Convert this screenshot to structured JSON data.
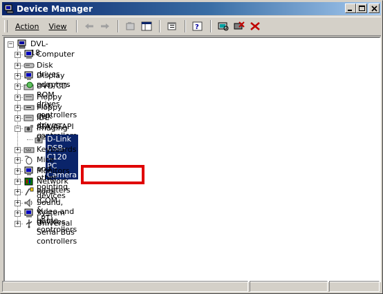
{
  "window": {
    "title": "Device Manager",
    "title_color": "#0a246a"
  },
  "toolbar": {
    "menu_action": "Action",
    "menu_view": "View",
    "buttons": [
      "back-icon",
      "forward-icon",
      "up-icon",
      "properties-pane-icon",
      "properties-icon",
      "help-icon",
      "scan-hardware-icon",
      "uninstall-icon",
      "disable-icon"
    ]
  },
  "tree": {
    "root": "DVL-18",
    "items": [
      {
        "label": "Computer",
        "icon": "computer-icon",
        "expanded": false
      },
      {
        "label": "Disk drives",
        "icon": "disk-drive-icon",
        "expanded": false
      },
      {
        "label": "Display adapters",
        "icon": "display-icon",
        "expanded": false
      },
      {
        "label": "DVD/CD-ROM drives",
        "icon": "cdrom-icon",
        "expanded": false
      },
      {
        "label": "Floppy disk controllers",
        "icon": "floppy-controller-icon",
        "expanded": false
      },
      {
        "label": "Floppy disk drives",
        "icon": "floppy-drive-icon",
        "expanded": false
      },
      {
        "label": "IDE ATA/ATAPI controllers",
        "icon": "ide-controller-icon",
        "expanded": false
      },
      {
        "label": "Imaging devices",
        "icon": "camera-icon",
        "expanded": true
      },
      {
        "label": "Keyboards",
        "icon": "keyboard-icon",
        "expanded": false
      },
      {
        "label": "Mice and other pointing devices",
        "icon": "mouse-icon",
        "expanded": false
      },
      {
        "label": "Monitors",
        "icon": "monitor-icon",
        "expanded": false
      },
      {
        "label": "Network adapters",
        "icon": "network-icon",
        "expanded": false
      },
      {
        "label": "Ports (COM & LPT)",
        "icon": "port-icon",
        "expanded": false
      },
      {
        "label": "Sound, video and game controllers",
        "icon": "sound-icon",
        "expanded": false
      },
      {
        "label": "System devices",
        "icon": "system-icon",
        "expanded": false
      },
      {
        "label": "Universal Serial Bus controllers",
        "icon": "usb-icon",
        "expanded": false
      }
    ],
    "child_of_imaging": "D-Link DSB-C120 PC Camera",
    "highlight_color": "#e00000"
  }
}
